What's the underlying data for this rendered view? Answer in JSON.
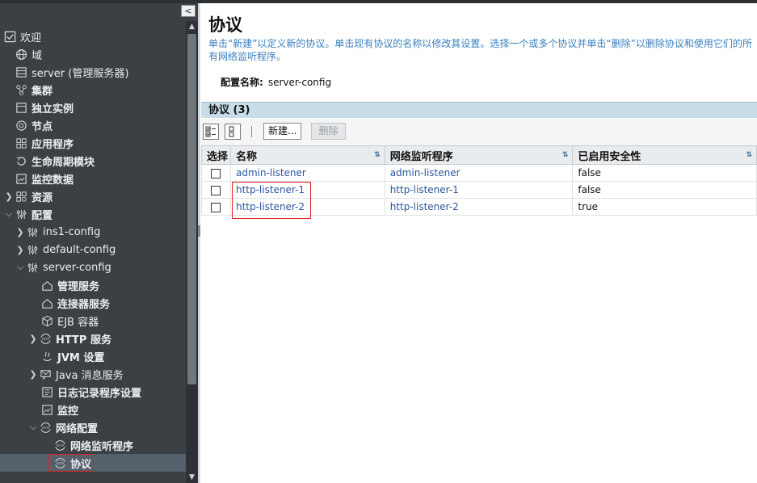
{
  "sidebar": {
    "collapse_glyph": "<",
    "items": [
      {
        "label": "欢迎",
        "icon": "check-square-icon",
        "indent": 0
      },
      {
        "label": "域",
        "icon": "globe-icon",
        "indent": 1
      },
      {
        "label": "server (管理服务器)",
        "icon": "server-icon",
        "indent": 1
      },
      {
        "label": "集群",
        "icon": "cluster-icon",
        "indent": 1
      },
      {
        "label": "独立实例",
        "icon": "instance-icon",
        "indent": 1
      },
      {
        "label": "节点",
        "icon": "node-icon",
        "indent": 1
      },
      {
        "label": "应用程序",
        "icon": "applications-icon",
        "indent": 1
      },
      {
        "label": "生命周期模块",
        "icon": "lifecycle-icon",
        "indent": 1
      },
      {
        "label": "监控数据",
        "icon": "monitor-chart-icon",
        "indent": 1
      },
      {
        "label": "资源",
        "icon": "resources-icon",
        "indent": 1
      },
      {
        "label": "配置",
        "icon": "config-sliders-icon",
        "indent": 1
      },
      {
        "label": "ins1-config",
        "icon": "config-sliders-icon",
        "indent": 2
      },
      {
        "label": "default-config",
        "icon": "config-sliders-icon",
        "indent": 2
      },
      {
        "label": "server-config",
        "icon": "config-sliders-icon",
        "indent": 2
      },
      {
        "label": "管理服务",
        "icon": "house-icon",
        "indent": 3
      },
      {
        "label": "连接器服务",
        "icon": "house-icon",
        "indent": 3
      },
      {
        "label": "EJB 容器",
        "icon": "cube-icon",
        "indent": 3
      },
      {
        "label": "HTTP 服务",
        "icon": "http-globe-icon",
        "indent": 3
      },
      {
        "label": "JVM 设置",
        "icon": "jvm-icon",
        "indent": 3
      },
      {
        "label": "Java 消息服务",
        "icon": "message-icon",
        "indent": 3
      },
      {
        "label": "日志记录程序设置",
        "icon": "log-icon",
        "indent": 3
      },
      {
        "label": "监控",
        "icon": "monitor-chart-icon",
        "indent": 3
      },
      {
        "label": "网络配置",
        "icon": "http-globe-icon",
        "indent": 3
      },
      {
        "label": "网络监听程序",
        "icon": "http-globe-icon",
        "indent": 4
      },
      {
        "label": "协议",
        "icon": "http-globe-icon",
        "indent": 4
      }
    ]
  },
  "main": {
    "title": "协议",
    "help": "单击“新建”以定义新的协议。单击现有协议的名称以修改其设置。选择一个或多个协议并单击“删除”以删除协议和使用它们的所有网络监听程序。",
    "config_label": "配置名称:",
    "config_value": "server-config",
    "table_title": "协议 (3)",
    "toolbar": {
      "select_all_icon": "select-all-icon",
      "deselect_all_icon": "deselect-all-icon",
      "new_label": "新建...",
      "delete_label": "删除"
    },
    "columns": [
      "选择",
      "名称",
      "网络监听程序",
      "已启用安全性"
    ],
    "rows": [
      {
        "name": "admin-listener",
        "listener": "admin-listener",
        "security": "false"
      },
      {
        "name": "http-listener-1",
        "listener": "http-listener-1",
        "security": "false"
      },
      {
        "name": "http-listener-2",
        "listener": "http-listener-2",
        "security": "true"
      }
    ]
  },
  "colors": {
    "sidebar_bg": "#3b4045",
    "table_title_bg": "#c9dde8",
    "link": "#2a56a0",
    "help_text": "#3a7fbf",
    "highlight": "#dd2222"
  }
}
